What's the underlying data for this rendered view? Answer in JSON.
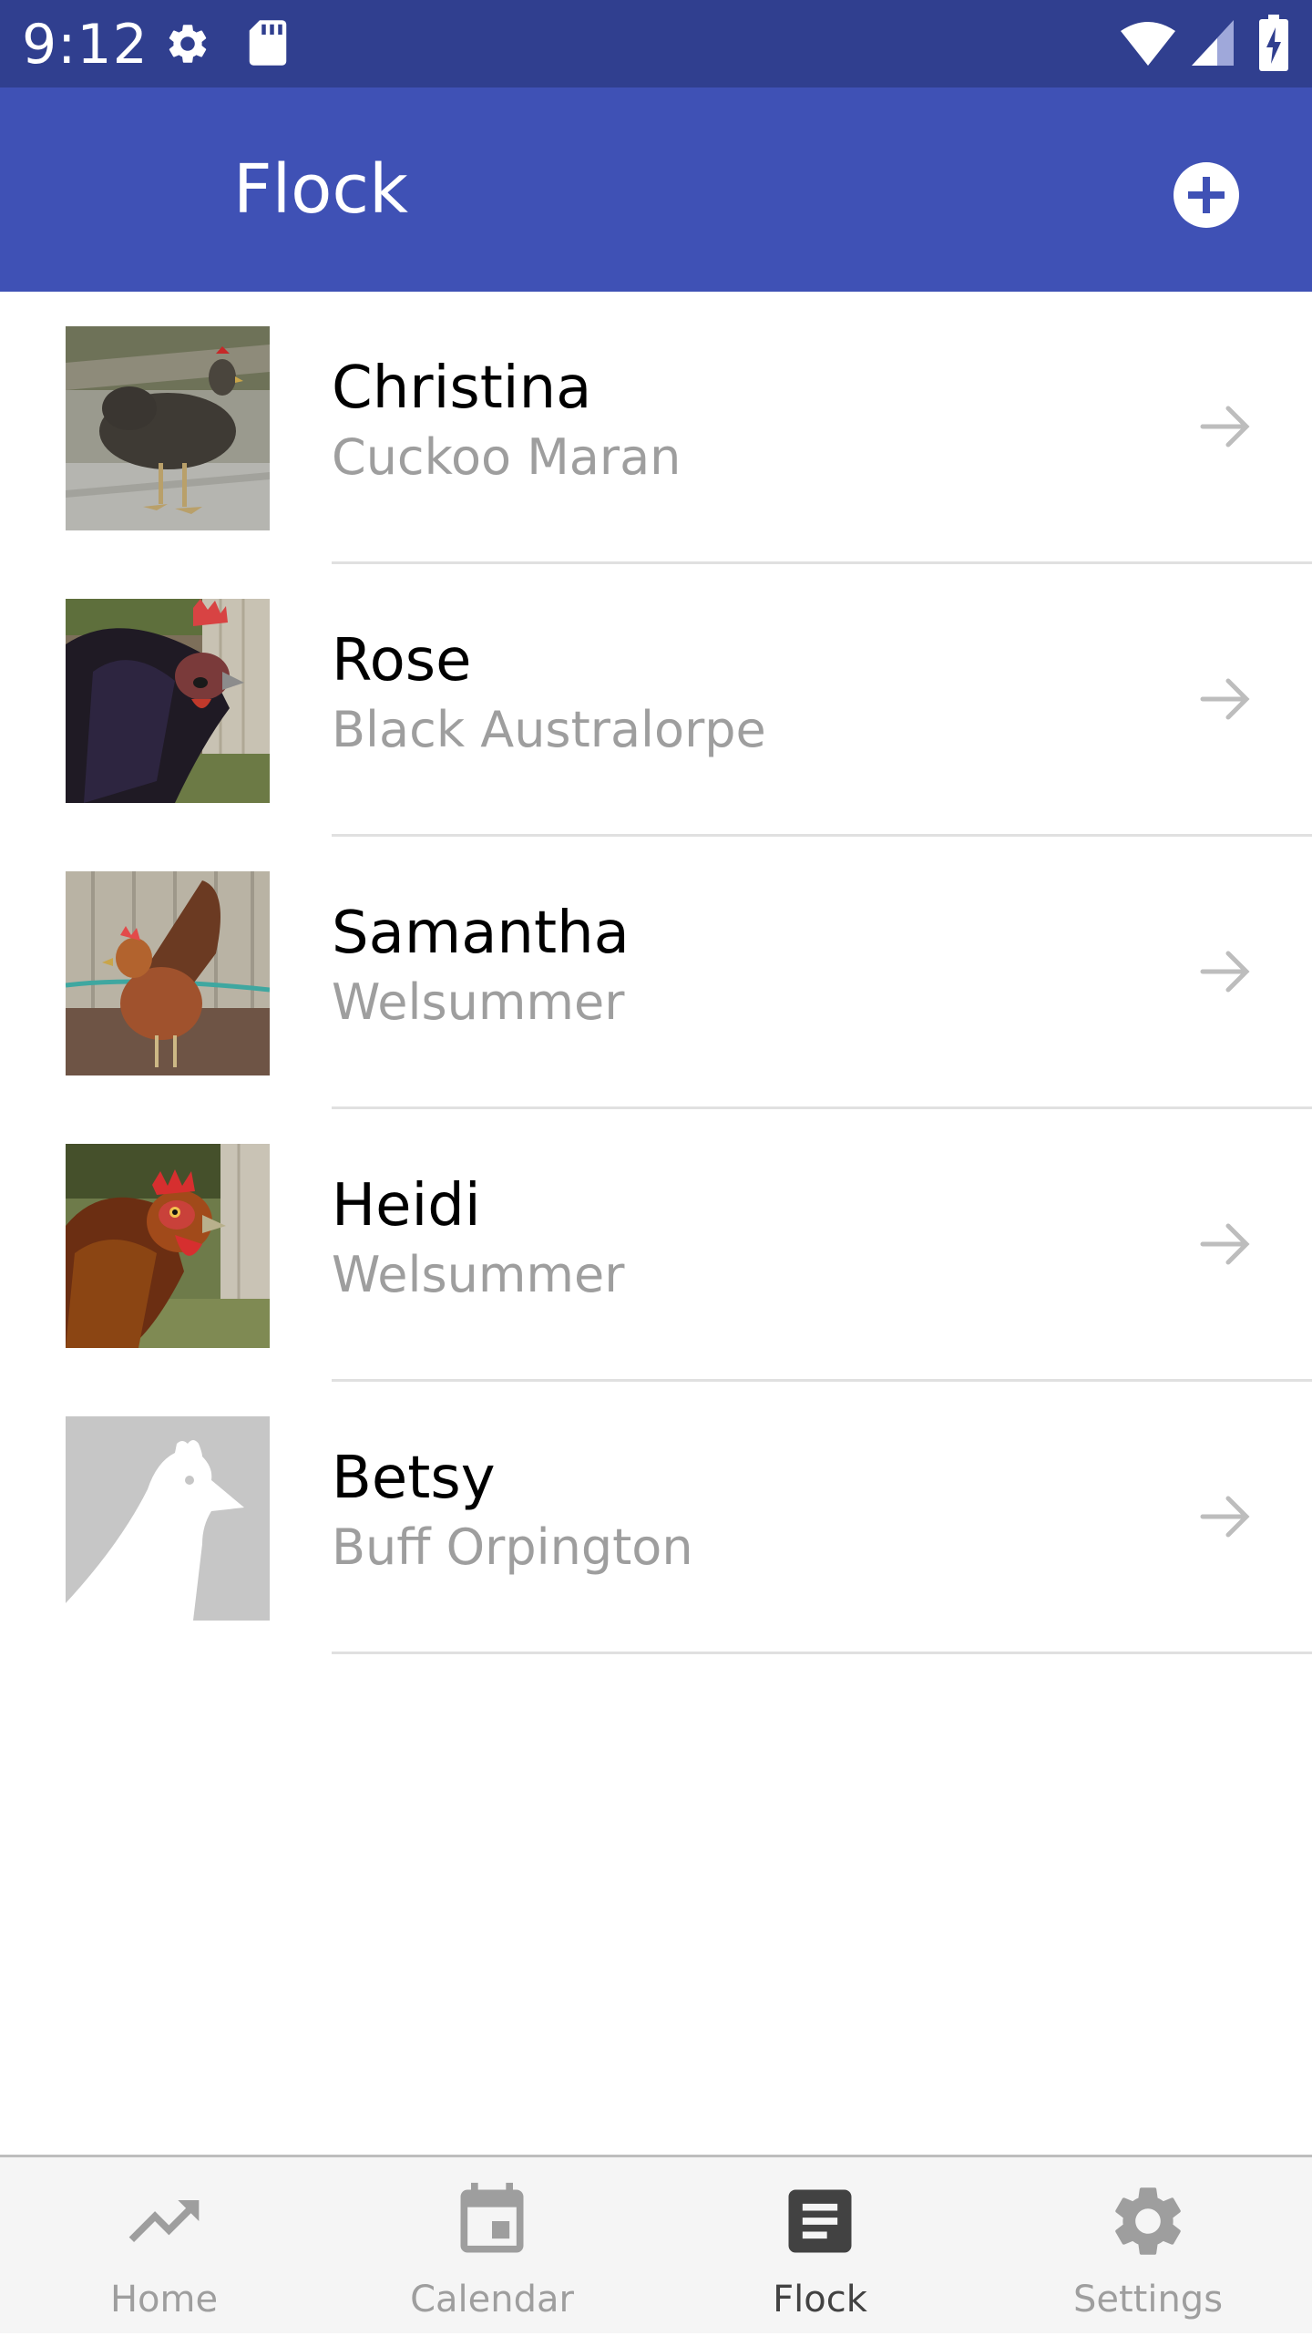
{
  "status_bar": {
    "time": "9:12",
    "icons": [
      "gear-icon",
      "sd-card-icon",
      "wifi-icon",
      "cell-signal-icon",
      "battery-charging-icon"
    ]
  },
  "app_bar": {
    "title": "Flock",
    "action_icon": "add-circle-icon",
    "background": "#3F51B5",
    "status_background": "#303F8F"
  },
  "flock": {
    "items": [
      {
        "name": "Christina",
        "breed": "Cuckoo Maran",
        "photo": "chicken-photo"
      },
      {
        "name": "Rose",
        "breed": "Black Australorpe",
        "photo": "chicken-photo"
      },
      {
        "name": "Samantha",
        "breed": "Welsummer",
        "photo": "chicken-photo"
      },
      {
        "name": "Heidi",
        "breed": "Welsummer",
        "photo": "chicken-photo"
      },
      {
        "name": "Betsy",
        "breed": "Buff Orpington",
        "photo": "placeholder-chicken-silhouette"
      }
    ]
  },
  "bottom_nav": {
    "items": [
      {
        "label": "Home",
        "icon": "trending-up-icon",
        "active": false
      },
      {
        "label": "Calendar",
        "icon": "calendar-icon",
        "active": false
      },
      {
        "label": "Flock",
        "icon": "list-document-icon",
        "active": true
      },
      {
        "label": "Settings",
        "icon": "gear-icon",
        "active": false
      }
    ]
  }
}
